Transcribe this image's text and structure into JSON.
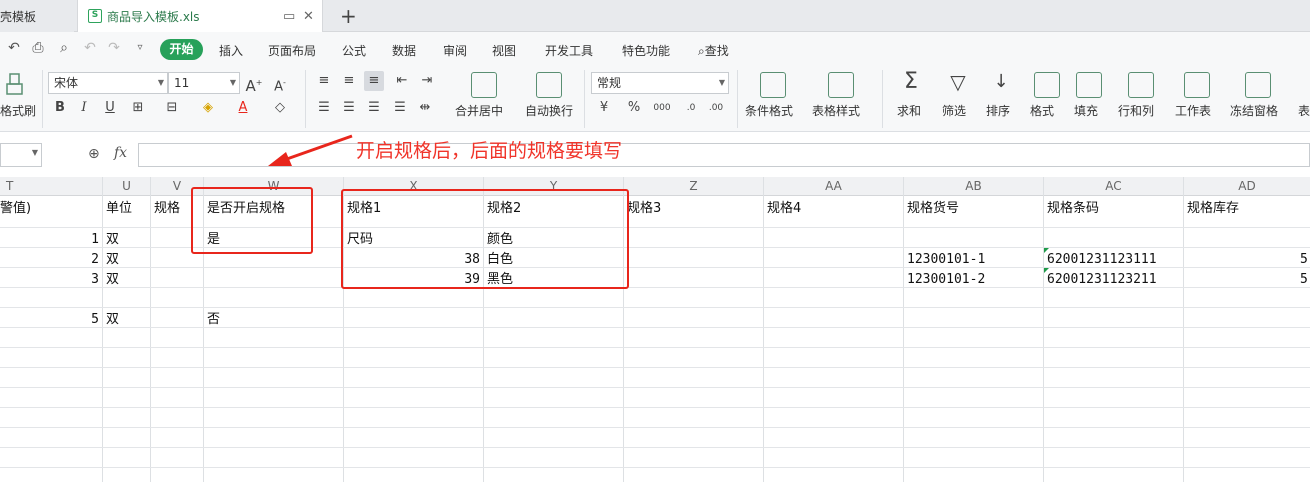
{
  "tabs": {
    "previous_label": "壳模板",
    "active_label": "商品导入模板.xls",
    "new_tab_symbol": "+"
  },
  "menu": {
    "items": [
      "开始",
      "插入",
      "页面布局",
      "公式",
      "数据",
      "审阅",
      "视图",
      "开发工具",
      "特色功能"
    ],
    "search_label": "查找"
  },
  "ribbon": {
    "format_brush": "格式刷",
    "font_name": "宋体",
    "font_size": "11",
    "number_format": "常规",
    "merge_center": "合并居中",
    "wrap_text": "自动换行",
    "conditional_format": "条件格式",
    "table_style": "表格样式",
    "sum": "求和",
    "filter": "筛选",
    "sort": "排序",
    "format": "格式",
    "fill": "填充",
    "rows_cols": "行和列",
    "worksheet": "工作表",
    "freeze": "冻结窗格",
    "more": "表"
  },
  "formula_bar": {
    "fx_label": "fx",
    "annotation": "开启规格后，后面的规格要填写"
  },
  "columns": [
    "T",
    "U",
    "V",
    "W",
    "X",
    "Y",
    "Z",
    "AA",
    "AB",
    "AC",
    "AD"
  ],
  "header_row": {
    "T": "警值)",
    "U": "单位",
    "V": "规格",
    "W": "是否开启规格",
    "X": "规格1",
    "Y": "规格2",
    "Z": "规格3",
    "AA": "规格4",
    "AB": "规格货号",
    "AC": "规格条码",
    "AD": "规格库存"
  },
  "rows": [
    {
      "T": "1",
      "U": "双",
      "W": "是",
      "X": "尺码",
      "Y": "颜色"
    },
    {
      "T": "2",
      "U": "双",
      "X": "38",
      "Y": "白色",
      "AB": "12300101-1",
      "AC": "62001231123111",
      "AD": "5"
    },
    {
      "T": "3",
      "U": "双",
      "X": "39",
      "Y": "黑色",
      "AB": "12300101-2",
      "AC": "62001231123211",
      "AD": "5"
    },
    {},
    {
      "T": "5",
      "U": "双",
      "W": "否"
    }
  ],
  "colors": {
    "accent": "#27a15a",
    "annotation_red": "#f0342a"
  }
}
